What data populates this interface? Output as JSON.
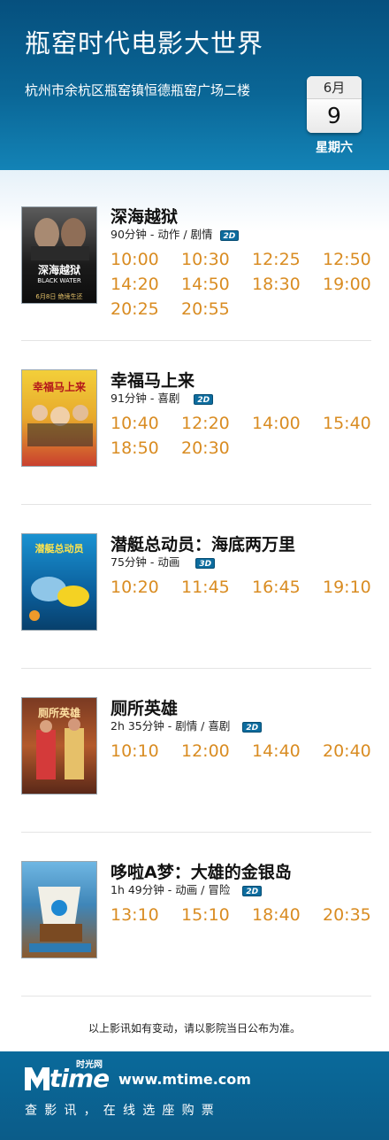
{
  "header": {
    "cinema_name": "瓶窑时代电影大世界",
    "address": "杭州市余杭区瓶窑镇恒德瓶窑广场二楼",
    "date_month": "6月",
    "date_day": "9",
    "weekday": "星期六"
  },
  "movies": [
    {
      "title": "深海越狱",
      "meta": "90分钟 - 动作 / 剧情",
      "format": "2D",
      "poster_title": "深海越狱",
      "poster_sub": "BLACK WATER",
      "poster_date": "6月8日 绝境生还",
      "times": [
        "10:00",
        "10:30",
        "12:25",
        "12:50",
        "14:20",
        "14:50",
        "18:30",
        "19:00",
        "20:25",
        "20:55"
      ]
    },
    {
      "title": "幸福马上来",
      "meta": "91分钟 - 喜剧",
      "format": "2D",
      "poster_title": "幸福马上来",
      "poster_sub": "",
      "poster_date": "",
      "times": [
        "10:40",
        "12:20",
        "14:00",
        "15:40",
        "18:50",
        "20:30"
      ]
    },
    {
      "title": "潜艇总动员：海底两万里",
      "meta": "75分钟 - 动画",
      "format": "3D",
      "poster_title": "潜艇总动员",
      "poster_sub": "",
      "poster_date": "",
      "times": [
        "10:20",
        "11:45",
        "16:45",
        "19:10"
      ]
    },
    {
      "title": "厕所英雄",
      "meta": "2h 35分钟 - 剧情 / 喜剧",
      "format": "2D",
      "poster_title": "厕所英雄",
      "poster_sub": "",
      "poster_date": "",
      "times": [
        "10:10",
        "12:00",
        "14:40",
        "20:40"
      ]
    },
    {
      "title": "哆啦A梦：大雄的金银岛",
      "meta": "1h 49分钟 - 动画 / 冒险",
      "format": "2D",
      "poster_title": "",
      "poster_sub": "",
      "poster_date": "",
      "times": [
        "13:10",
        "15:10",
        "18:40",
        "20:35"
      ]
    }
  ],
  "notice": "以上影讯如有变动，请以影院当日公布为准。",
  "footer": {
    "logo_word": "time",
    "logo_cn": "时光网",
    "url": "www.mtime.com",
    "slogan": "查影讯，在线选座购票"
  },
  "colors": {
    "header_blue": "#0a6696",
    "showtime_orange": "#d98c22",
    "badge_blue": "#0d6c9e"
  }
}
